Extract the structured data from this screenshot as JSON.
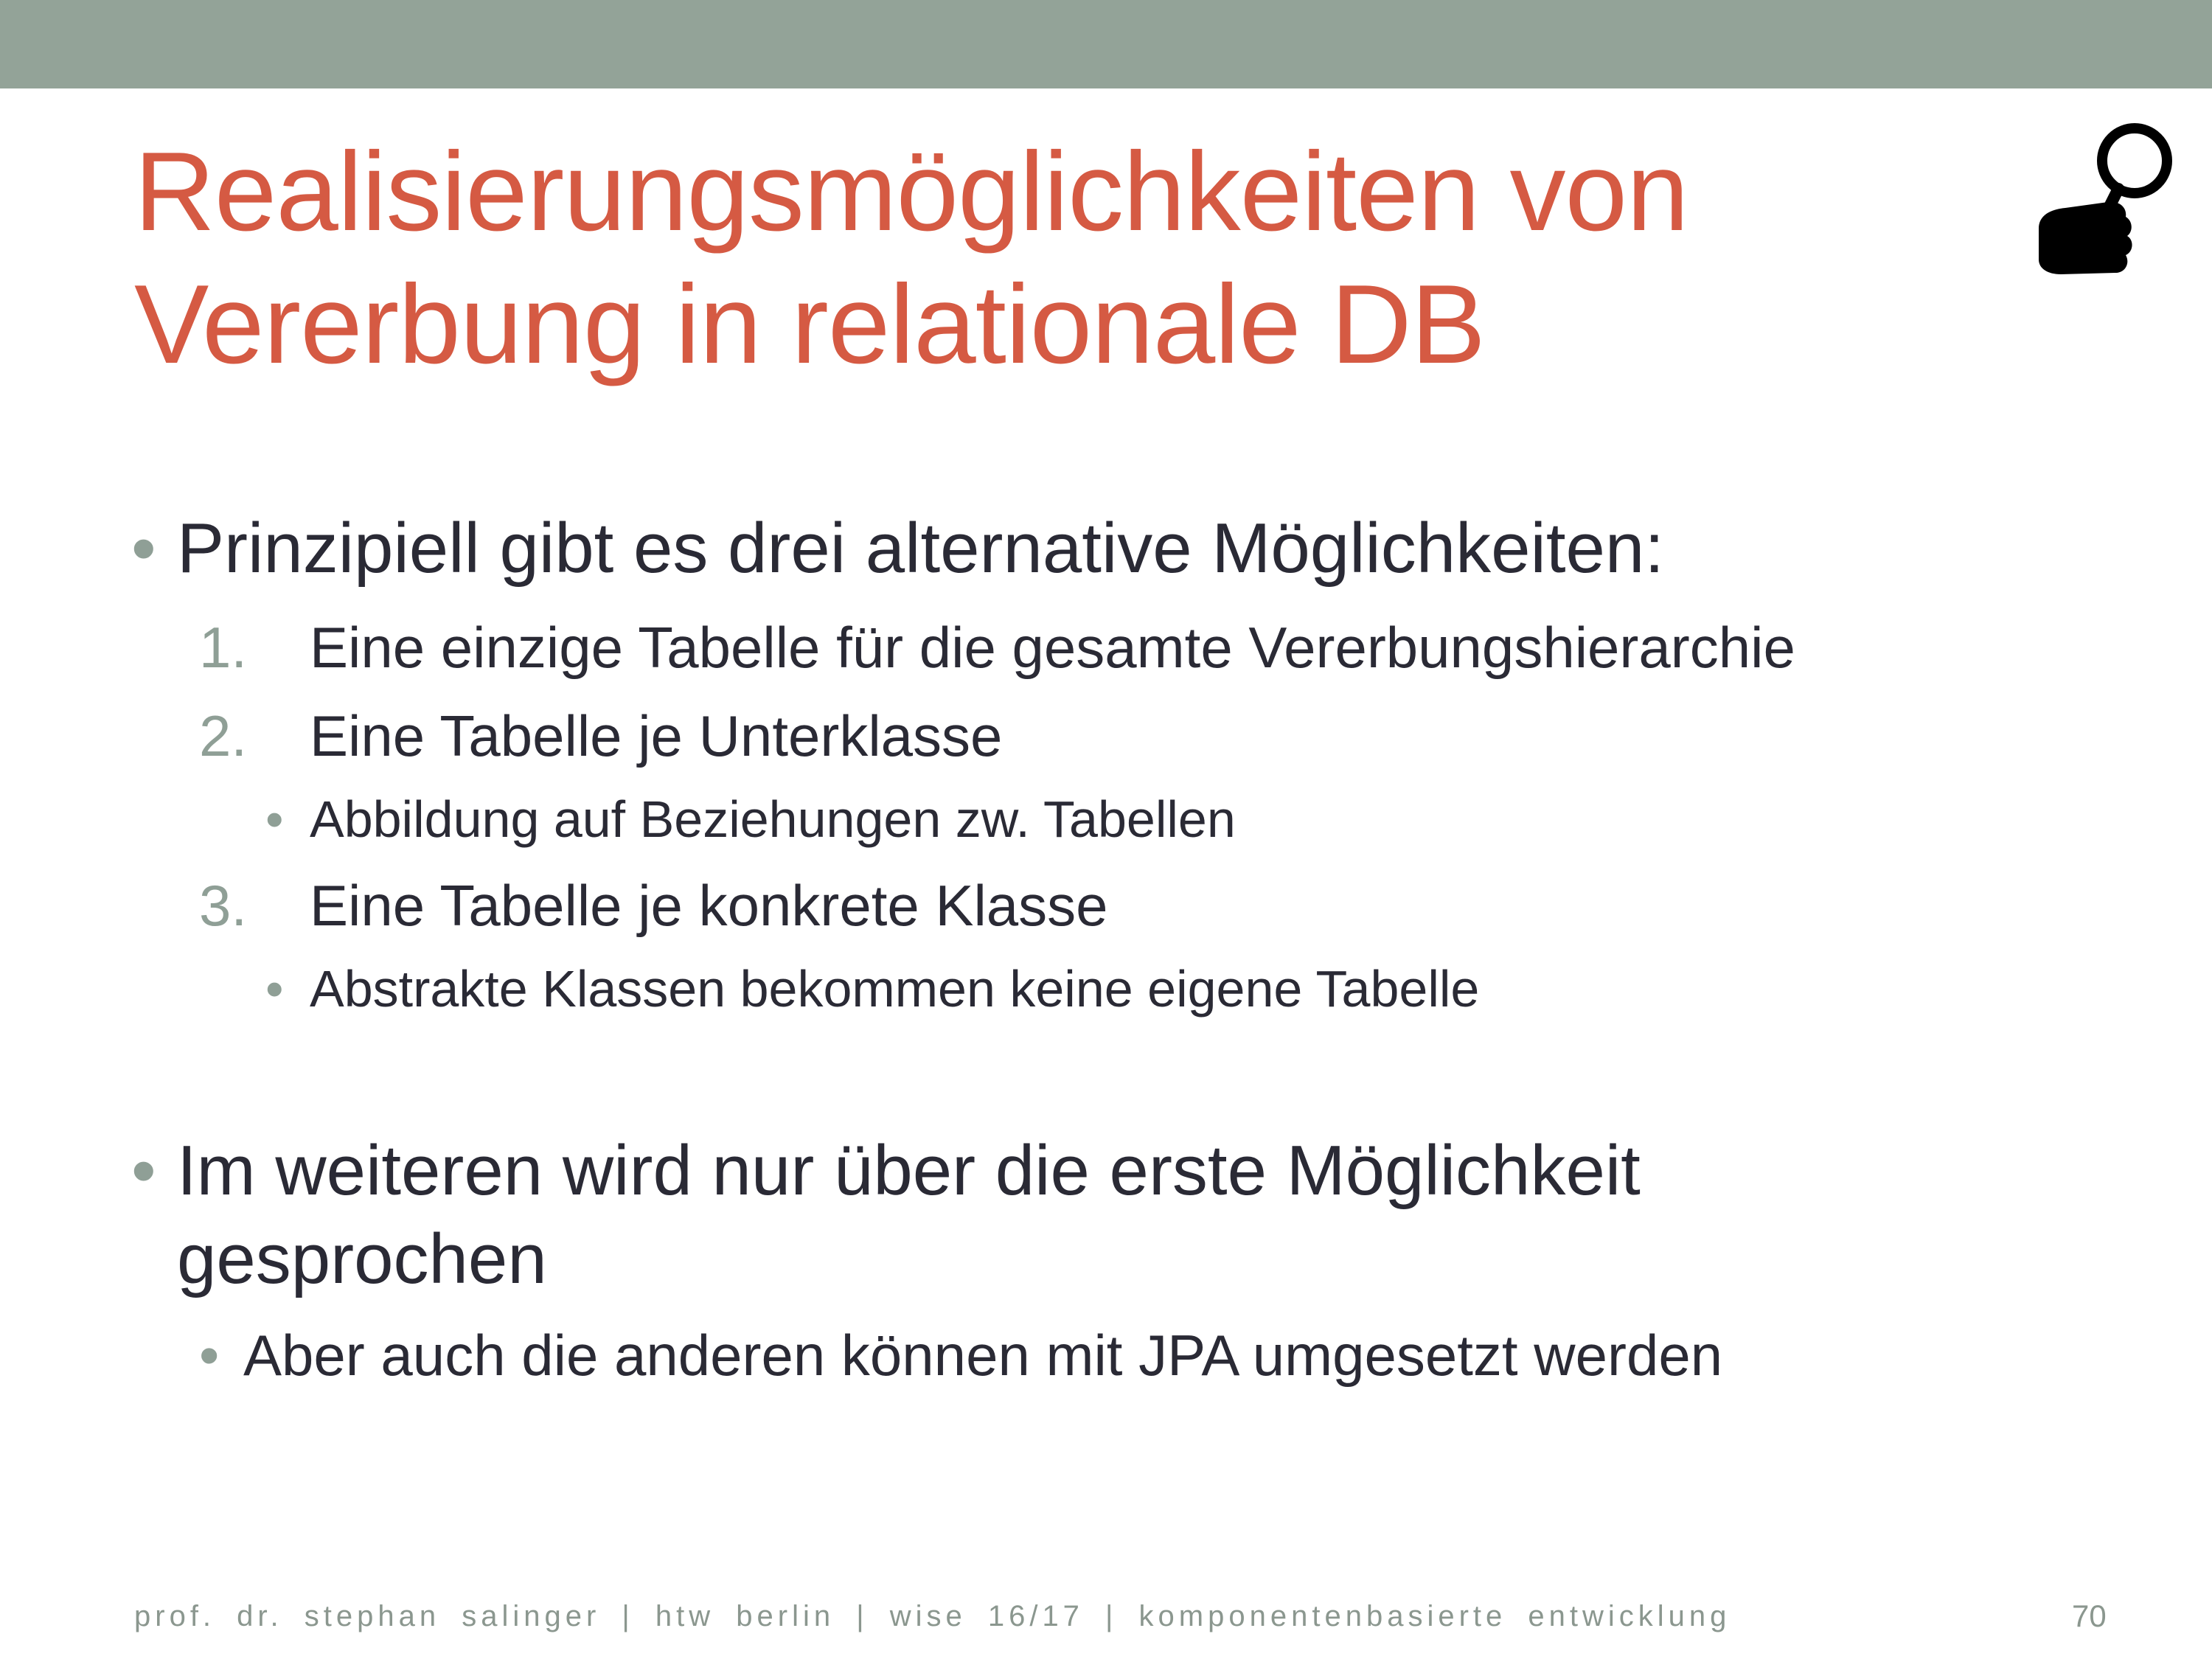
{
  "slide": {
    "title": "Realisierungsmöglichkeiten von Vererbung in relationale DB",
    "bullets": {
      "b1": "Prinzipiell gibt es drei alternative Möglichkeiten:",
      "n1_num": "1.",
      "n1": "Eine einzige Tabelle für die gesamte Vererbungshierarchie",
      "n2_num": "2.",
      "n2": "Eine Tabelle je Unterklasse",
      "n2_sub": "Abbildung auf Beziehungen zw. Tabellen",
      "n3_num": "3.",
      "n3": "Eine Tabelle je konkrete Klasse",
      "n3_sub": "Abstrakte Klassen bekommen keine eigene Tabelle",
      "b2_line1": "Im weiteren wird nur über die erste Möglichkeit",
      "b2_line2": "gesprochen",
      "b2_sub": "Aber auch die anderen können mit JPA umgesetzt werden"
    },
    "footer": "prof. dr. stephan salinger | htw berlin | wise 16/17 | komponentenbasierte entwicklung",
    "page_number": "70",
    "icon": "magnifier-hand-icon",
    "colors": {
      "top_bar": "#93a398",
      "title": "#d55a43",
      "text": "#2a2a35",
      "bullet": "#8f9f96"
    }
  }
}
